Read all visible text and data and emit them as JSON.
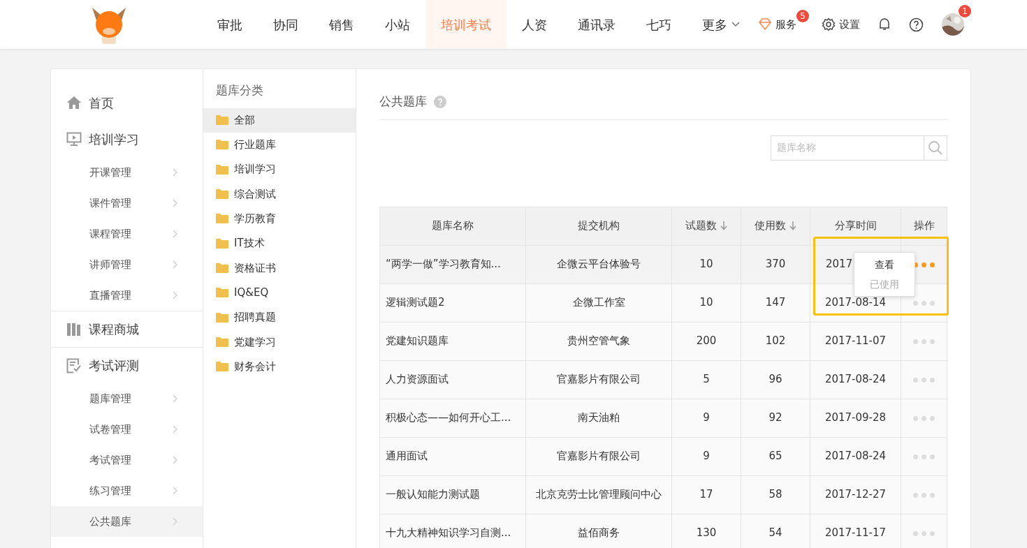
{
  "nav": {
    "items": [
      {
        "label": "审批",
        "selected": false,
        "kind": "link"
      },
      {
        "label": "协同",
        "selected": false,
        "kind": "link"
      },
      {
        "label": "销售",
        "selected": false,
        "kind": "link"
      },
      {
        "label": "小站",
        "selected": false,
        "kind": "link"
      },
      {
        "label": "培训考试",
        "selected": true,
        "kind": "link"
      },
      {
        "label": "人资",
        "selected": false,
        "kind": "link"
      },
      {
        "label": "通讯录",
        "selected": false,
        "kind": "link"
      },
      {
        "label": "七巧",
        "selected": false,
        "kind": "link"
      },
      {
        "label": "更多",
        "selected": false,
        "kind": "dropdown"
      }
    ]
  },
  "actions": {
    "service": {
      "label": "服务",
      "badge": "5"
    },
    "settings": {
      "label": "设置"
    },
    "avatar": {
      "badge": "1"
    }
  },
  "sidebar": {
    "items": [
      {
        "label": "首页",
        "kind": "home"
      },
      {
        "label": "培训学习",
        "kind": "monitor",
        "children": [
          {
            "label": "开课管理",
            "selected": false
          },
          {
            "label": "课件管理",
            "selected": false
          },
          {
            "label": "课程管理",
            "selected": false
          },
          {
            "label": "讲师管理",
            "selected": false
          },
          {
            "label": "直播管理",
            "selected": false
          }
        ]
      },
      {
        "label": "课程商城",
        "kind": "books"
      },
      {
        "label": "考试评测",
        "kind": "exam",
        "children": [
          {
            "label": "题库管理",
            "selected": false
          },
          {
            "label": "试卷管理",
            "selected": false
          },
          {
            "label": "考试管理",
            "selected": false
          },
          {
            "label": "练习管理",
            "selected": false
          },
          {
            "label": "公共题库",
            "selected": true
          }
        ]
      }
    ]
  },
  "categories": {
    "title": "题库分类",
    "items": [
      {
        "label": "全部",
        "selected": true
      },
      {
        "label": "行业题库",
        "selected": false
      },
      {
        "label": "培训学习",
        "selected": false
      },
      {
        "label": "综合测试",
        "selected": false
      },
      {
        "label": "学历教育",
        "selected": false
      },
      {
        "label": "IT技术",
        "selected": false
      },
      {
        "label": "资格证书",
        "selected": false
      },
      {
        "label": "IQ&EQ",
        "selected": false
      },
      {
        "label": "招聘真题",
        "selected": false
      },
      {
        "label": "党建学习",
        "selected": false
      },
      {
        "label": "财务会计",
        "selected": false
      }
    ]
  },
  "main": {
    "title": "公共题库",
    "search": {
      "placeholder": "题库名称"
    },
    "table": {
      "columns": [
        {
          "label": "题库名称",
          "sortable": false
        },
        {
          "label": "提交机构",
          "sortable": false
        },
        {
          "label": "试题数",
          "sortable": true
        },
        {
          "label": "使用数",
          "sortable": true
        },
        {
          "label": "分享时间",
          "sortable": false
        },
        {
          "label": "操作",
          "sortable": false
        }
      ],
      "rows": [
        {
          "cells": [
            "“两学一做”学习教育知...",
            "企微云平台体验号",
            "10",
            "370",
            "2017"
          ],
          "selected": true
        },
        {
          "cells": [
            "逻辑测试题2",
            "企微工作室",
            "10",
            "147",
            "2017-08-14"
          ],
          "selected": false
        },
        {
          "cells": [
            "党建知识题库",
            "贵州空管气象",
            "200",
            "102",
            "2017-11-07"
          ],
          "selected": false
        },
        {
          "cells": [
            "人力资源面试",
            "官嘉影片有限公司",
            "5",
            "96",
            "2017-08-24"
          ],
          "selected": false
        },
        {
          "cells": [
            "积极心态——如何开心工...",
            "南天油粕",
            "9",
            "92",
            "2017-09-28"
          ],
          "selected": false
        },
        {
          "cells": [
            "通用面试",
            "官嘉影片有限公司",
            "9",
            "65",
            "2017-08-24"
          ],
          "selected": false
        },
        {
          "cells": [
            "一般认知能力测试题",
            "北京克劳士比管理顾问中心",
            "17",
            "58",
            "2017-12-27"
          ],
          "selected": false
        },
        {
          "cells": [
            "十九大精神知识学习自测...",
            "益佰商务",
            "130",
            "54",
            "2017-11-17"
          ],
          "selected": false
        }
      ]
    },
    "menu": {
      "items": [
        {
          "label": "查看",
          "disabled": false
        },
        {
          "label": "已使用",
          "disabled": true
        }
      ]
    }
  }
}
